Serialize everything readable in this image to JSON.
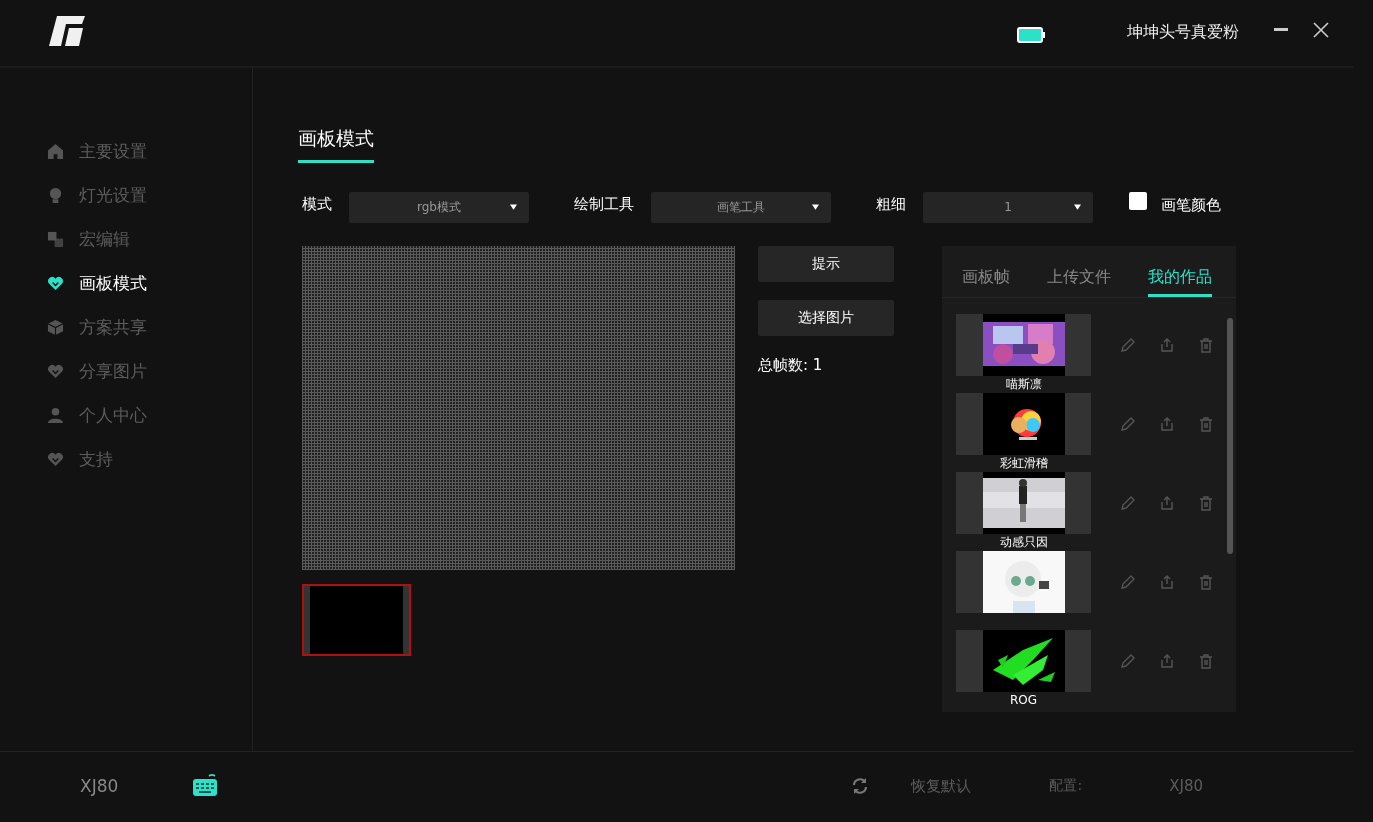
{
  "header": {
    "username": "坤坤头号真爱粉"
  },
  "sidebar": [
    {
      "label": "主要设置",
      "selected": false
    },
    {
      "label": "灯光设置",
      "selected": false
    },
    {
      "label": "宏编辑",
      "selected": false
    },
    {
      "label": "画板模式",
      "selected": true
    },
    {
      "label": "方案共享",
      "selected": false
    },
    {
      "label": "分享图片",
      "selected": false
    },
    {
      "label": "个人中心",
      "selected": false
    },
    {
      "label": "支持",
      "selected": false
    }
  ],
  "page_title": "画板模式",
  "controls": [
    {
      "label": "模式",
      "value": "rgb模式"
    },
    {
      "label": "绘制工具",
      "value": "画笔工具"
    },
    {
      "label": "粗细",
      "value": "1"
    }
  ],
  "pen_color": {
    "label": "画笔颜色"
  },
  "frames": [
    {
      "selected": true
    }
  ],
  "buttons": [
    "提示",
    "选择图片"
  ],
  "frame_count": "总帧数: 1",
  "panel_tabs": [
    {
      "label": "画板帧",
      "selected": false
    },
    {
      "label": "上传文件",
      "selected": false
    },
    {
      "label": "我的作品",
      "selected": true
    }
  ],
  "works": [
    {
      "name": "喵斯凛",
      "kind": "picture"
    },
    {
      "name": "彩虹滑稽",
      "kind": "picture"
    },
    {
      "name": "动感只因",
      "kind": "picture"
    },
    {
      "kind": "picture"
    },
    {
      "name": "ROG",
      "kind": "picture"
    }
  ],
  "footer": {
    "device": "XJ80",
    "restore": "恢复默认",
    "config_label": "配置:",
    "config_value": "XJ80"
  }
}
